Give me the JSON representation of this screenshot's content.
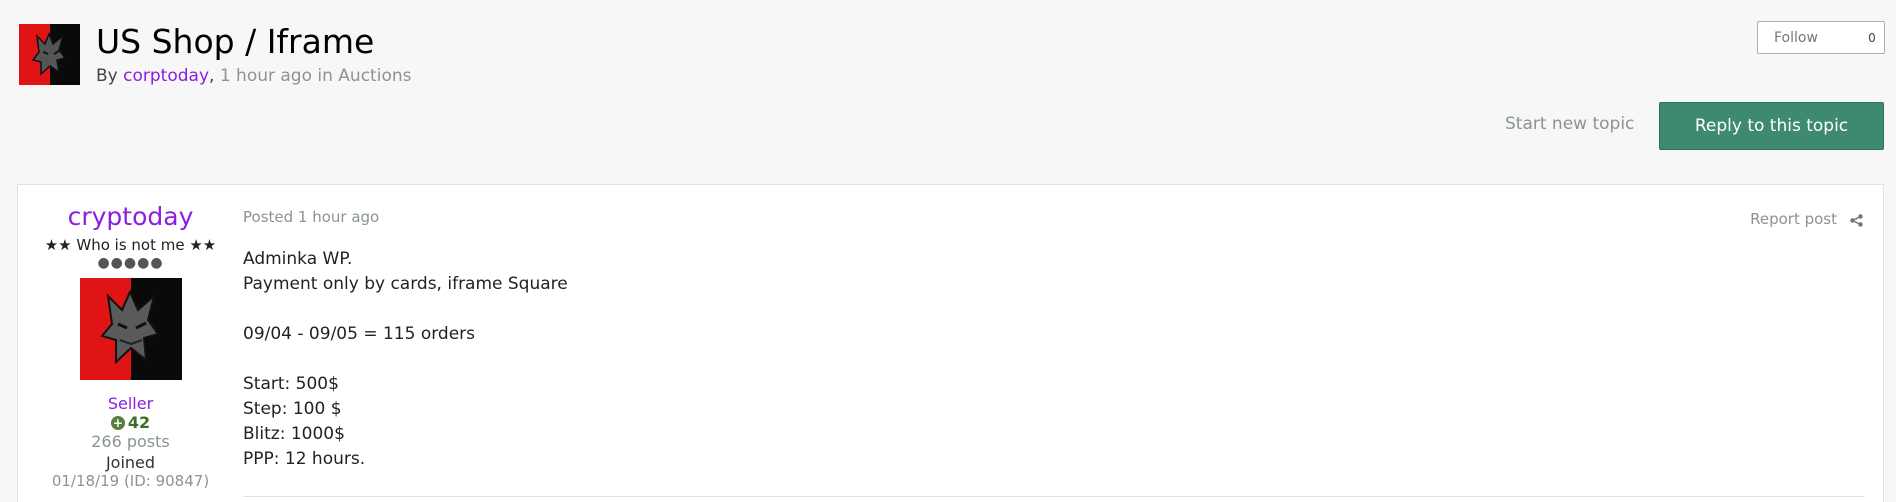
{
  "topic": {
    "title": "US Shop / Iframe",
    "byline": {
      "by_label": "By",
      "author": "corptoday",
      "comma": ",",
      "time_forum": "1 hour ago in Auctions"
    }
  },
  "actions": {
    "follow_label": "Follow",
    "follow_count": "0",
    "start_new_topic": "Start new topic",
    "reply_label": "Reply to this topic"
  },
  "post": {
    "author": {
      "name": "cryptoday",
      "title": "★★ Who is not me ★★",
      "rank_dots": "●●●●●",
      "group": "Seller",
      "reputation": "42",
      "posts": "266 posts",
      "joined_label": "Joined",
      "joined_value": "01/18/19 (ID: 90847)"
    },
    "meta": "Posted 1 hour ago",
    "report_label": "Report post",
    "content": {
      "line1": "Adminka WP.",
      "line2": "Payment only by cards, iframe Square",
      "line3": "09/04 - 09/05 = 115 orders",
      "line4": "Start: 500$",
      "line5": "Step: 100 $",
      "line6": "Blitz: 1000$",
      "line7": "PPP: 12 hours."
    }
  },
  "icons": {
    "share": "share-icon",
    "reputation": "plus-circle-icon"
  },
  "colors": {
    "accent_green": "#3e8a6f",
    "author_purple": "#8b1ee0",
    "muted_gray": "#8a9399"
  }
}
